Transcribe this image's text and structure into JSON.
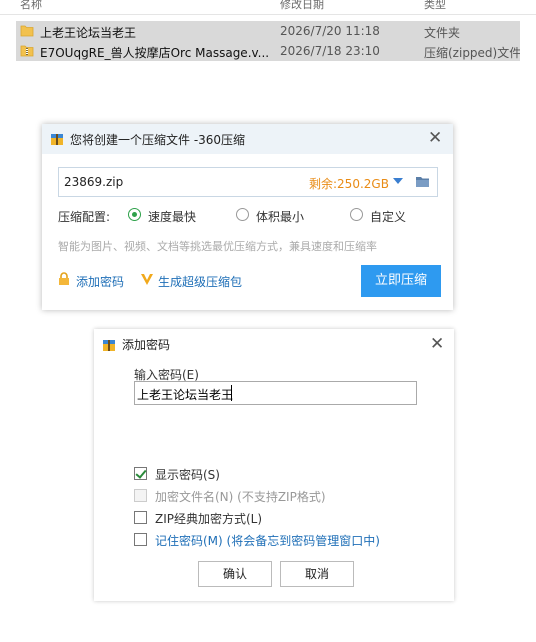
{
  "explorer": {
    "columns": [
      "名称",
      "修改日期",
      "类型"
    ],
    "rows": [
      {
        "name": "上老王论坛当老王",
        "date": "2026/7/20 11:18",
        "type": "文件夹",
        "icon": "folder-icon"
      },
      {
        "name": "E7OUqgRE_兽人按摩店Orc Massage.v...",
        "date": "2026/7/18 23:10",
        "type": "压缩(zipped)文件",
        "icon": "zip-folder-icon"
      }
    ]
  },
  "compress_dialog": {
    "title": "您将创建一个压缩文件 -360压缩",
    "filename": "23869.zip",
    "free_space": "剩余:250.2GB",
    "config_label": "压缩配置:",
    "options": [
      "速度最快",
      "体积最小",
      "自定义"
    ],
    "selected_option": "速度最快",
    "hint": "智能为图片、视频、文档等挑选最优压缩方式，兼具速度和压缩率",
    "add_password": "添加密码",
    "super_package": "生成超级压缩包",
    "compress_now": "立即压缩",
    "colors": {
      "accent": "#2e9af0",
      "free_space": "#e98c16",
      "radio_on": "#2ea14a"
    }
  },
  "password_dialog": {
    "title": "添加密码",
    "input_label": "输入密码(E)",
    "password_value": "上老王论坛当老王",
    "options": [
      {
        "label": "显示密码(S)",
        "checked": true,
        "disabled": false
      },
      {
        "label": "加密文件名(N) (不支持ZIP格式)",
        "checked": false,
        "disabled": true
      },
      {
        "label": "ZIP经典加密方式(L)",
        "checked": false,
        "disabled": false
      },
      {
        "label": "记住密码(M) (将会备忘到密码管理窗口中)",
        "checked": false,
        "disabled": false
      }
    ],
    "ok": "确认",
    "cancel": "取消"
  }
}
